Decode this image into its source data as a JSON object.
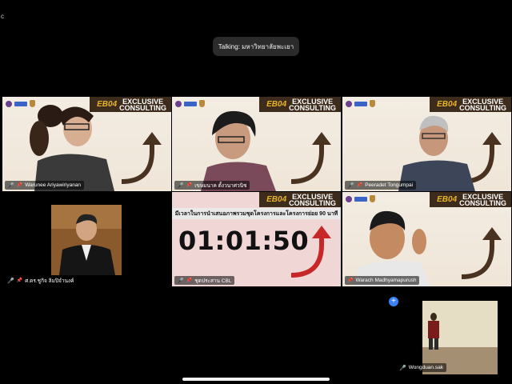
{
  "corner_text": "c",
  "talking": "Talking: มหาวิทยาลัยพะเยา",
  "banner": {
    "code": "EB04",
    "word1": "EXCLUSIVE",
    "word2": "CONSULTING"
  },
  "timer_tile": {
    "heading": "มีเวลาในการนำเสนอภาพรวมชุดโครงการและโครงการย่อย 90 นาที",
    "time": "01:01:50"
  },
  "participants": [
    {
      "name": "Warunee Ariyawiriyanan",
      "muted": true
    },
    {
      "name": "เขษมนาค ตั้งวนาศวนิช",
      "muted": true
    },
    {
      "name": "Peeradet Tongumpai",
      "muted": true
    },
    {
      "name": "ศ.ดร.ชูกิจ ลิมปิจำนงค์",
      "muted": true
    },
    {
      "name": "ชุดประสาน CBL",
      "muted": true
    },
    {
      "name": "Warach Madhyamapurush",
      "muted": false
    },
    {
      "name": "Wongduan.sak",
      "muted": true
    }
  ],
  "icons": {
    "mic_muted": "🎤",
    "pin": "📌",
    "add": "+"
  },
  "colors": {
    "accent_gold": "#e8b326",
    "banner_brown": "#3d2b1c",
    "timer_pink": "#f1d6d6",
    "mute_red": "#e53935",
    "self_view_blue": "#3a82f7"
  }
}
